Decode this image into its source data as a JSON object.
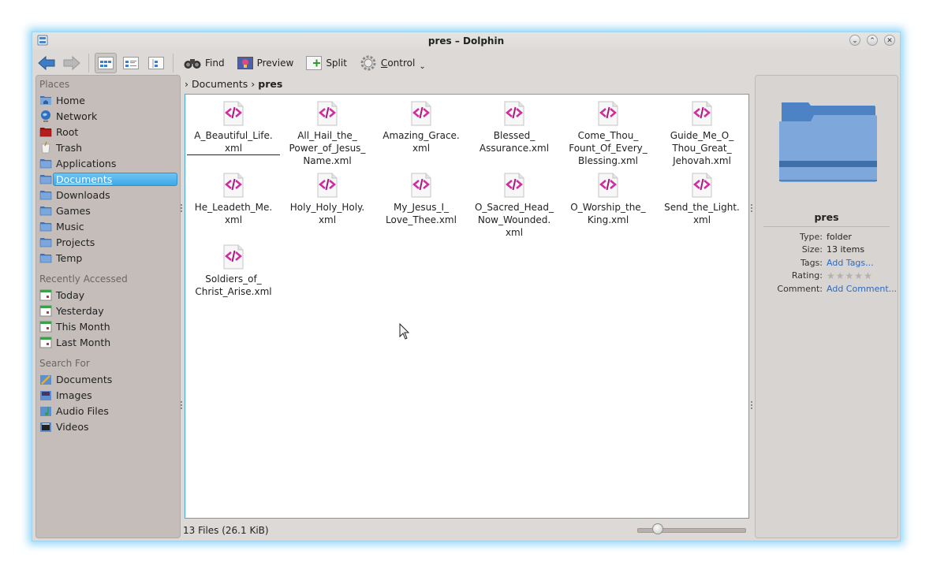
{
  "window": {
    "title": "pres – Dolphin",
    "buttons": [
      "minimize",
      "maximize",
      "close"
    ]
  },
  "toolbar": {
    "back_icon": "arrow-left-icon",
    "forward_icon": "arrow-right-icon",
    "view_modes": [
      "icons",
      "details",
      "columns"
    ],
    "active_view": "icons",
    "find_label": "Find",
    "preview_label": "Preview",
    "split_label": "Split",
    "control_label": "Control"
  },
  "places": {
    "sections": [
      {
        "title": "Places",
        "items": [
          {
            "label": "Home",
            "icon": "home-folder-icon"
          },
          {
            "label": "Network",
            "icon": "network-globe-icon"
          },
          {
            "label": "Root",
            "icon": "root-folder-icon"
          },
          {
            "label": "Trash",
            "icon": "trash-icon"
          },
          {
            "label": "Applications",
            "icon": "folder-icon"
          },
          {
            "label": "Documents",
            "icon": "folder-icon",
            "selected": true
          },
          {
            "label": "Downloads",
            "icon": "folder-icon"
          },
          {
            "label": "Games",
            "icon": "folder-icon"
          },
          {
            "label": "Music",
            "icon": "folder-icon"
          },
          {
            "label": "Projects",
            "icon": "folder-icon"
          },
          {
            "label": "Temp",
            "icon": "folder-icon"
          }
        ]
      },
      {
        "title": "Recently Accessed",
        "items": [
          {
            "label": "Today",
            "icon": "calendar-today-icon"
          },
          {
            "label": "Yesterday",
            "icon": "calendar-yesterday-icon"
          },
          {
            "label": "This Month",
            "icon": "calendar-month-icon"
          },
          {
            "label": "Last Month",
            "icon": "calendar-month-icon"
          }
        ]
      },
      {
        "title": "Search For",
        "items": [
          {
            "label": "Documents",
            "icon": "documents-search-icon"
          },
          {
            "label": "Images",
            "icon": "images-search-icon"
          },
          {
            "label": "Audio Files",
            "icon": "audio-search-icon"
          },
          {
            "label": "Videos",
            "icon": "videos-search-icon"
          }
        ]
      }
    ]
  },
  "breadcrumb": {
    "items": [
      "Documents",
      "pres"
    ]
  },
  "files": [
    "A_Beautiful_Life.\nxml",
    "All_Hail_the_\nPower_of_Jesus_\nName.xml",
    "Amazing_Grace.\nxml",
    "Blessed_\nAssurance.xml",
    "Come_Thou_\nFount_Of_Every_\nBlessing.xml",
    "Guide_Me_O_\nThou_Great_\nJehovah.xml",
    "He_Leadeth_Me.\nxml",
    "Holy_Holy_Holy.\nxml",
    "My_Jesus_I_\nLove_Thee.xml",
    "O_Sacred_Head_\nNow_Wounded.\nxml",
    "O_Worship_the_\nKing.xml",
    "Send_the_Light.\nxml",
    "Soldiers_of_\nChrist_Arise.xml"
  ],
  "status": {
    "text": "13 Files (26.1 KiB)",
    "zoom_fraction": 0.15
  },
  "info_panel": {
    "name": "pres",
    "rows": [
      {
        "key": "Type:",
        "value": "folder"
      },
      {
        "key": "Size:",
        "value": "13 items"
      },
      {
        "key": "Tags:",
        "value": "Add Tags...",
        "link": true
      },
      {
        "key": "Rating:",
        "value": "",
        "rating": 0,
        "max": 5
      },
      {
        "key": "Comment:",
        "value": "Add Comment...",
        "link": true
      }
    ]
  }
}
